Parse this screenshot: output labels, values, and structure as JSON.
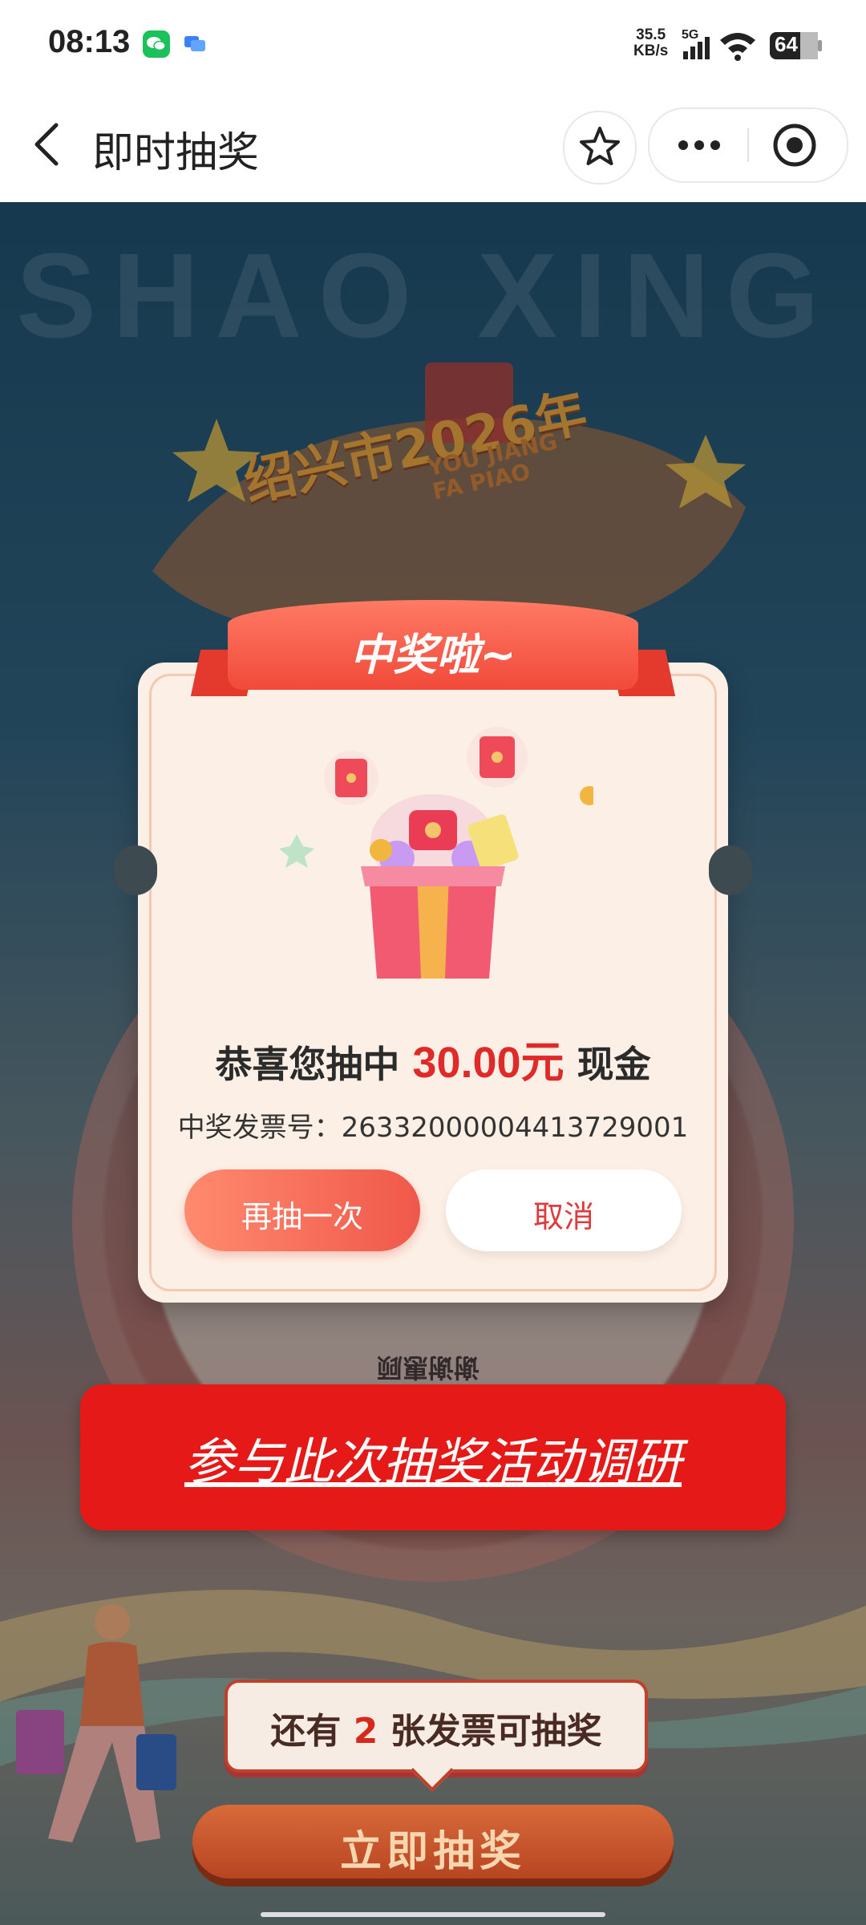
{
  "status_bar": {
    "time": "08:13",
    "net_speed_value": "35.5",
    "net_speed_unit": "KB/s",
    "network": "5G",
    "battery": "64"
  },
  "app_bar": {
    "title": "即时抽奖"
  },
  "background": {
    "watermark": "SHAO XING",
    "city_title": "绍兴市2026年",
    "subtitle_line1": "YOU JIANG",
    "subtitle_line2": "FA PIAO",
    "wheel_segment": "谢谢惠顾"
  },
  "dialog": {
    "ribbon_title": "中奖啦~",
    "congrats_prefix": "恭喜您抽中",
    "amount": "30.00元",
    "congrats_suffix": "现金",
    "invoice_label": "中奖发票号：",
    "invoice_number": "26332000004413729001",
    "again_button": "再抽一次",
    "cancel_button": "取消"
  },
  "survey": {
    "label": "参与此次抽奖活动调研"
  },
  "bottom": {
    "remain_prefix": "还有",
    "remain_count": "2",
    "remain_suffix": "张发票可抽奖",
    "draw_button": "立即抽奖"
  },
  "colors": {
    "accent_red": "#e61919",
    "amount_red": "#e02a2a",
    "dialog_bg": "#fcf0e6"
  }
}
